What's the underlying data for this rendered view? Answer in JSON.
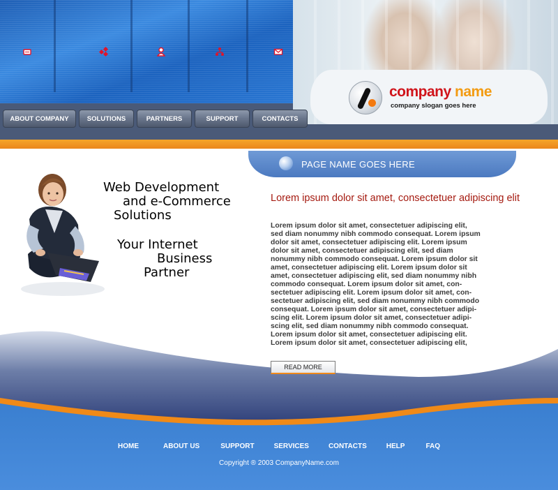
{
  "header": {
    "company_name_part1": "company",
    "company_name_part2": "name",
    "company_slogan": "company slogan goes here",
    "nav_icons": [
      "mail-card-icon",
      "puzzle-icon",
      "person-icon",
      "sitemap-icon",
      "envelope-icon"
    ],
    "nav": [
      {
        "label": "ABOUT COMPANY"
      },
      {
        "label": "SOLUTIONS"
      },
      {
        "label": "PARTNERS"
      },
      {
        "label": "SUPPORT"
      },
      {
        "label": "CONTACTS"
      }
    ],
    "accent_color": "#f39b12",
    "brand_color": "#d0141b"
  },
  "page_name": "PAGE NAME GOES HERE",
  "promo": {
    "line1": "Web Development",
    "line2": "and e-Commerce",
    "line3": "Solutions",
    "line4": "Your Internet",
    "line5": "Business",
    "line6": "Partner"
  },
  "content": {
    "title": "Lorem ipsum dolor sit amet, consectetuer adipiscing elit",
    "body": "Lorem ipsum dolor sit amet, consectetuer adipiscing elit,\nsed diam nonummy nibh commodo consequat. Lorem ipsum\ndolor sit amet, consectetuer adipiscing elit. Lorem ipsum\ndolor sit amet, consectetuer adipiscing elit, sed diam\nnonummy nibh commodo consequat. Lorem ipsum dolor sit\namet, consectetuer adipiscing elit. Lorem ipsum dolor sit\namet, consectetuer adipiscing elit, sed diam nonummy nibh\ncommodo consequat. Lorem ipsum dolor sit amet, con-\nsectetuer adipiscing elit. Lorem ipsum dolor sit amet, con-\nsectetuer adipiscing elit, sed diam nonummy nibh commodo\nconsequat. Lorem ipsum dolor sit amet, consectetuer adipi-\nscing elit. Lorem ipsum dolor sit amet, consectetuer adipi-\nscing elit, sed diam nonummy nibh commodo consequat.\nLorem ipsum dolor sit amet, consectetuer adipiscing elit.\nLorem ipsum dolor sit amet, consectetuer adipiscing elit,",
    "read_more": "READ MORE"
  },
  "footer": {
    "links": [
      {
        "label": "HOME"
      },
      {
        "label": "ABOUT US"
      },
      {
        "label": "SUPPORT"
      },
      {
        "label": "SERVICES"
      },
      {
        "label": "CONTACTS"
      },
      {
        "label": "HELP"
      },
      {
        "label": "FAQ"
      }
    ],
    "copyright": "Copyright ® 2003 CompanyName.com"
  }
}
